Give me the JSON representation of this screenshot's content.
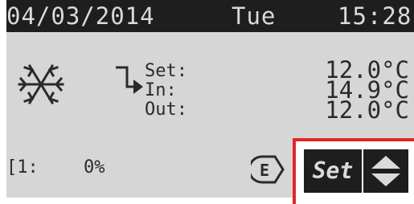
{
  "header": {
    "date": "04/03/2014",
    "day": "Tue",
    "time": "15:28"
  },
  "mode_icon": "snowflake-icon",
  "arrow_icon": "return-arrow-icon",
  "readings": {
    "set_label": "Set:",
    "set_value": "12.0°C",
    "in_label": "In:",
    "in_value": "14.9°C",
    "out_label": "Out:",
    "out_value": "12.0°C"
  },
  "output": {
    "label": "[1:",
    "value": "0%"
  },
  "status_icon": "e-badge-icon",
  "buttons": {
    "set_label": "Set",
    "updown_icon": "up-down-arrows-icon"
  },
  "colors": {
    "lcd_background": "#d6d6d6",
    "header_background": "#1e1e1e",
    "highlight_frame": "#e52626"
  }
}
